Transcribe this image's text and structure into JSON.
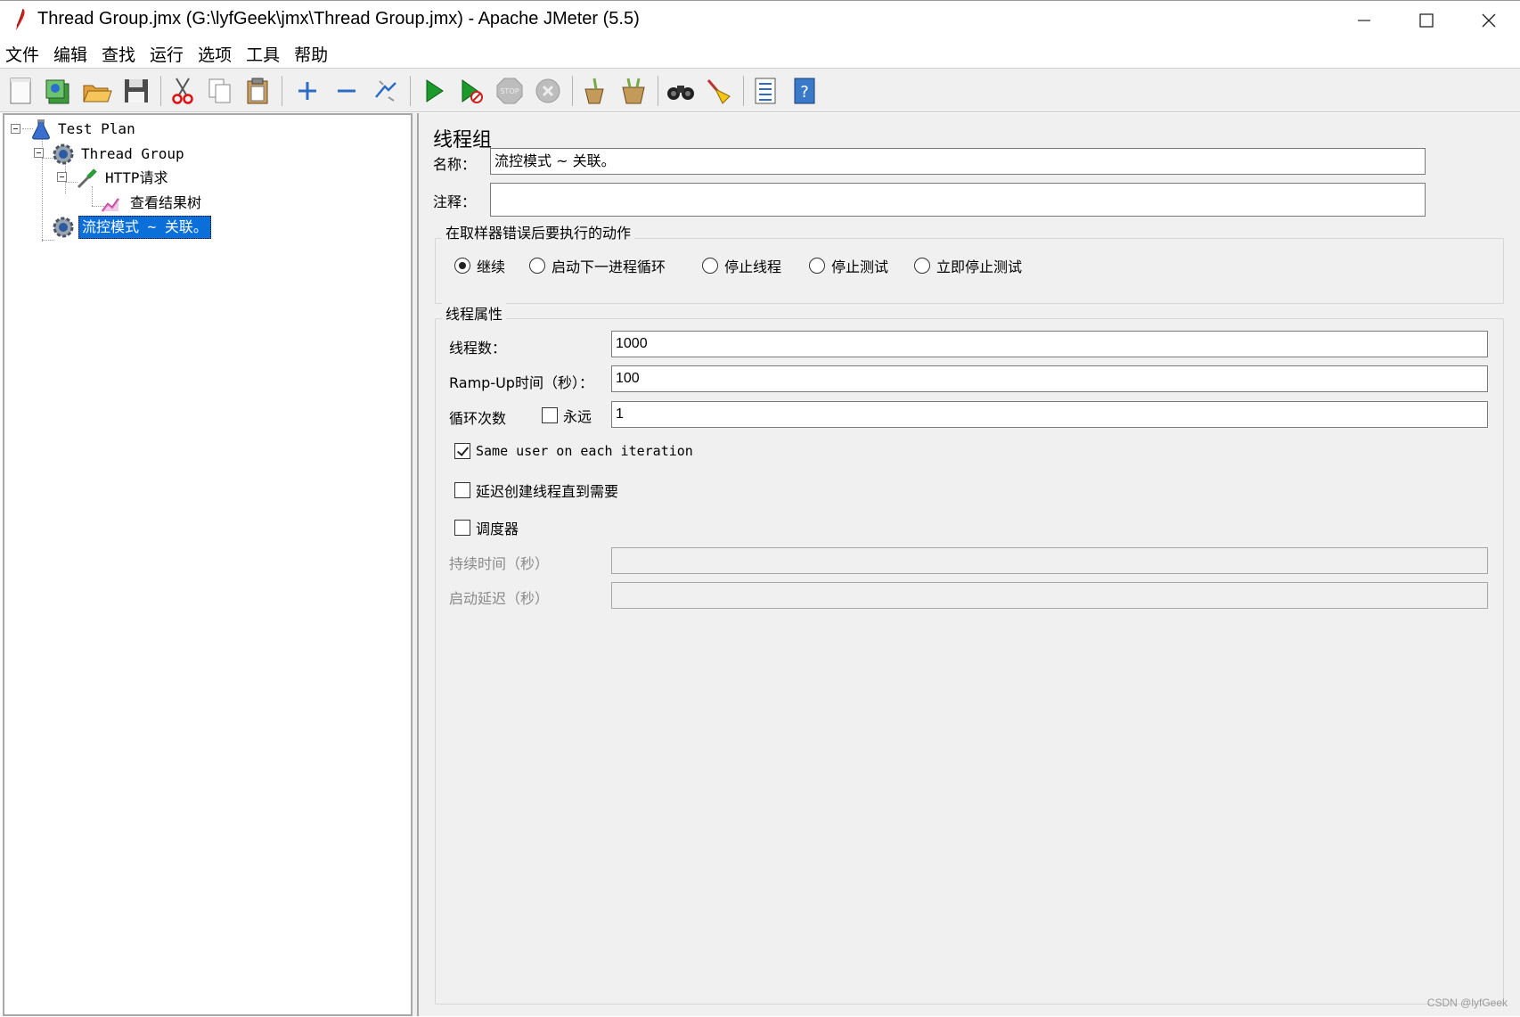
{
  "window": {
    "title": "Thread Group.jmx (G:\\lyfGeek\\jmx\\Thread Group.jmx) - Apache JMeter (5.5)"
  },
  "menu": [
    "文件",
    "编辑",
    "查找",
    "运行",
    "选项",
    "工具",
    "帮助"
  ],
  "toolbar": {
    "icons": [
      "new-icon",
      "templates-icon",
      "open-icon",
      "save-icon",
      "cut-icon",
      "copy-icon",
      "paste-icon",
      "expand-icon",
      "collapse-icon",
      "toggle-icon",
      "start-icon",
      "start-no-pauses-icon",
      "stop-icon",
      "shutdown-icon",
      "clear-icon",
      "clear-all-icon",
      "search-icon",
      "reset-search-icon",
      "function-helper-icon",
      "help-icon"
    ]
  },
  "tree": {
    "nodes": [
      {
        "label": "Test Plan",
        "icon": "flask-icon",
        "level": 0
      },
      {
        "label": "Thread Group",
        "icon": "gear-icon",
        "level": 1
      },
      {
        "label": "HTTP请求",
        "icon": "pipette-icon",
        "level": 2
      },
      {
        "label": "查看结果树",
        "icon": "graph-icon",
        "level": 3
      },
      {
        "label": "流控模式 ~ 关联。",
        "icon": "gear-icon",
        "level": 1,
        "selected": true
      }
    ]
  },
  "panel": {
    "title": "线程组",
    "name_label": "名称：",
    "name_value": "流控模式 ~ 关联。",
    "comment_label": "注释：",
    "comment_value": "",
    "error_action": {
      "title": "在取样器错误后要执行的动作",
      "options": [
        "继续",
        "启动下一进程循环",
        "停止线程",
        "停止测试",
        "立即停止测试"
      ],
      "selected": "继续"
    },
    "thread_props": {
      "title": "线程属性",
      "threads_label": "线程数：",
      "threads_value": "1000",
      "rampup_label": "Ramp-Up时间（秒）：",
      "rampup_value": "100",
      "loop_label": "循环次数",
      "forever_label": "永远",
      "forever_checked": false,
      "loop_value": "1",
      "same_user_label": "Same user on each iteration",
      "same_user_checked": true,
      "delay_label": "延迟创建线程直到需要",
      "delay_checked": false,
      "scheduler_label": "调度器",
      "scheduler_checked": false,
      "duration_label": "持续时间（秒）",
      "duration_value": "",
      "startup_delay_label": "启动延迟（秒）",
      "startup_delay_value": ""
    }
  },
  "watermark": "CSDN @lyfGeek"
}
